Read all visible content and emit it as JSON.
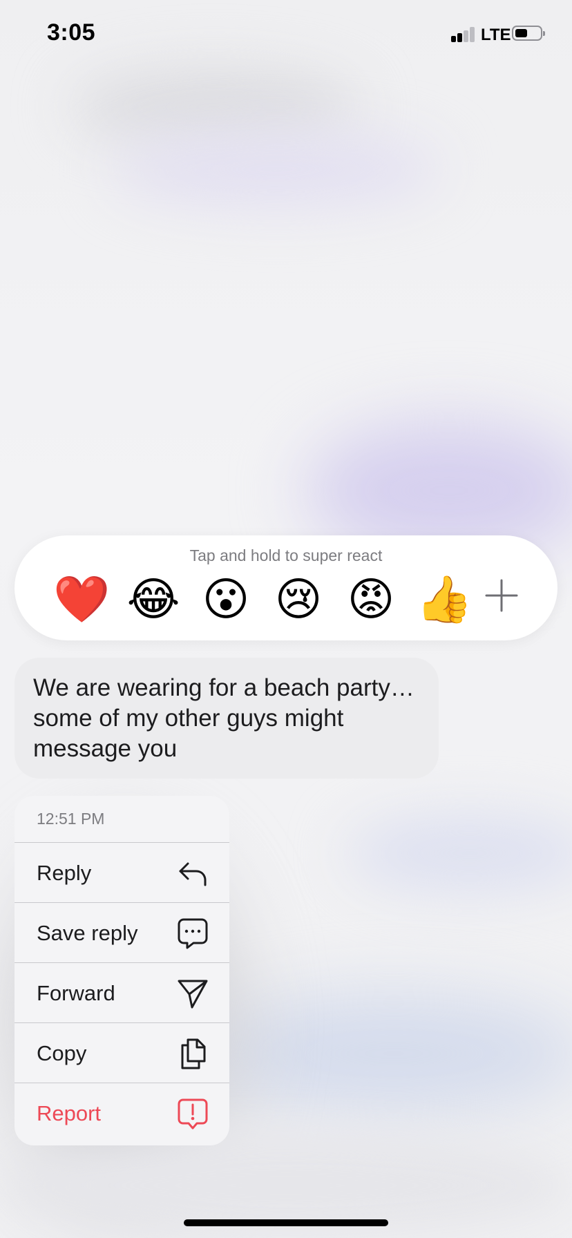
{
  "status_bar": {
    "time": "3:05",
    "network": "LTE"
  },
  "reactions": {
    "hint": "Tap and hold to super react",
    "emojis": [
      {
        "name": "red-heart",
        "glyph": "❤️"
      },
      {
        "name": "tears-of-joy",
        "glyph": "😂"
      },
      {
        "name": "hushed-face",
        "glyph": "😮"
      },
      {
        "name": "crying-face",
        "glyph": "😢"
      },
      {
        "name": "angry-face",
        "glyph": "😡"
      },
      {
        "name": "thumbs-up",
        "glyph": "👍"
      }
    ],
    "more_icon": "plus-icon"
  },
  "message": {
    "text": "We are wearing for a beach party… some of my other guys might message you"
  },
  "menu": {
    "timestamp": "12:51 PM",
    "items": [
      {
        "label": "Reply",
        "icon": "reply-arrow-icon"
      },
      {
        "label": "Save reply",
        "icon": "chat-bubble-dots-icon"
      },
      {
        "label": "Forward",
        "icon": "paper-plane-icon"
      },
      {
        "label": "Copy",
        "icon": "copy-documents-icon"
      },
      {
        "label": "Report",
        "icon": "report-exclamation-icon"
      }
    ]
  },
  "colors": {
    "danger": "#ed4956",
    "bubble": "#ececee",
    "menu_bg": "#f4f4f6"
  }
}
